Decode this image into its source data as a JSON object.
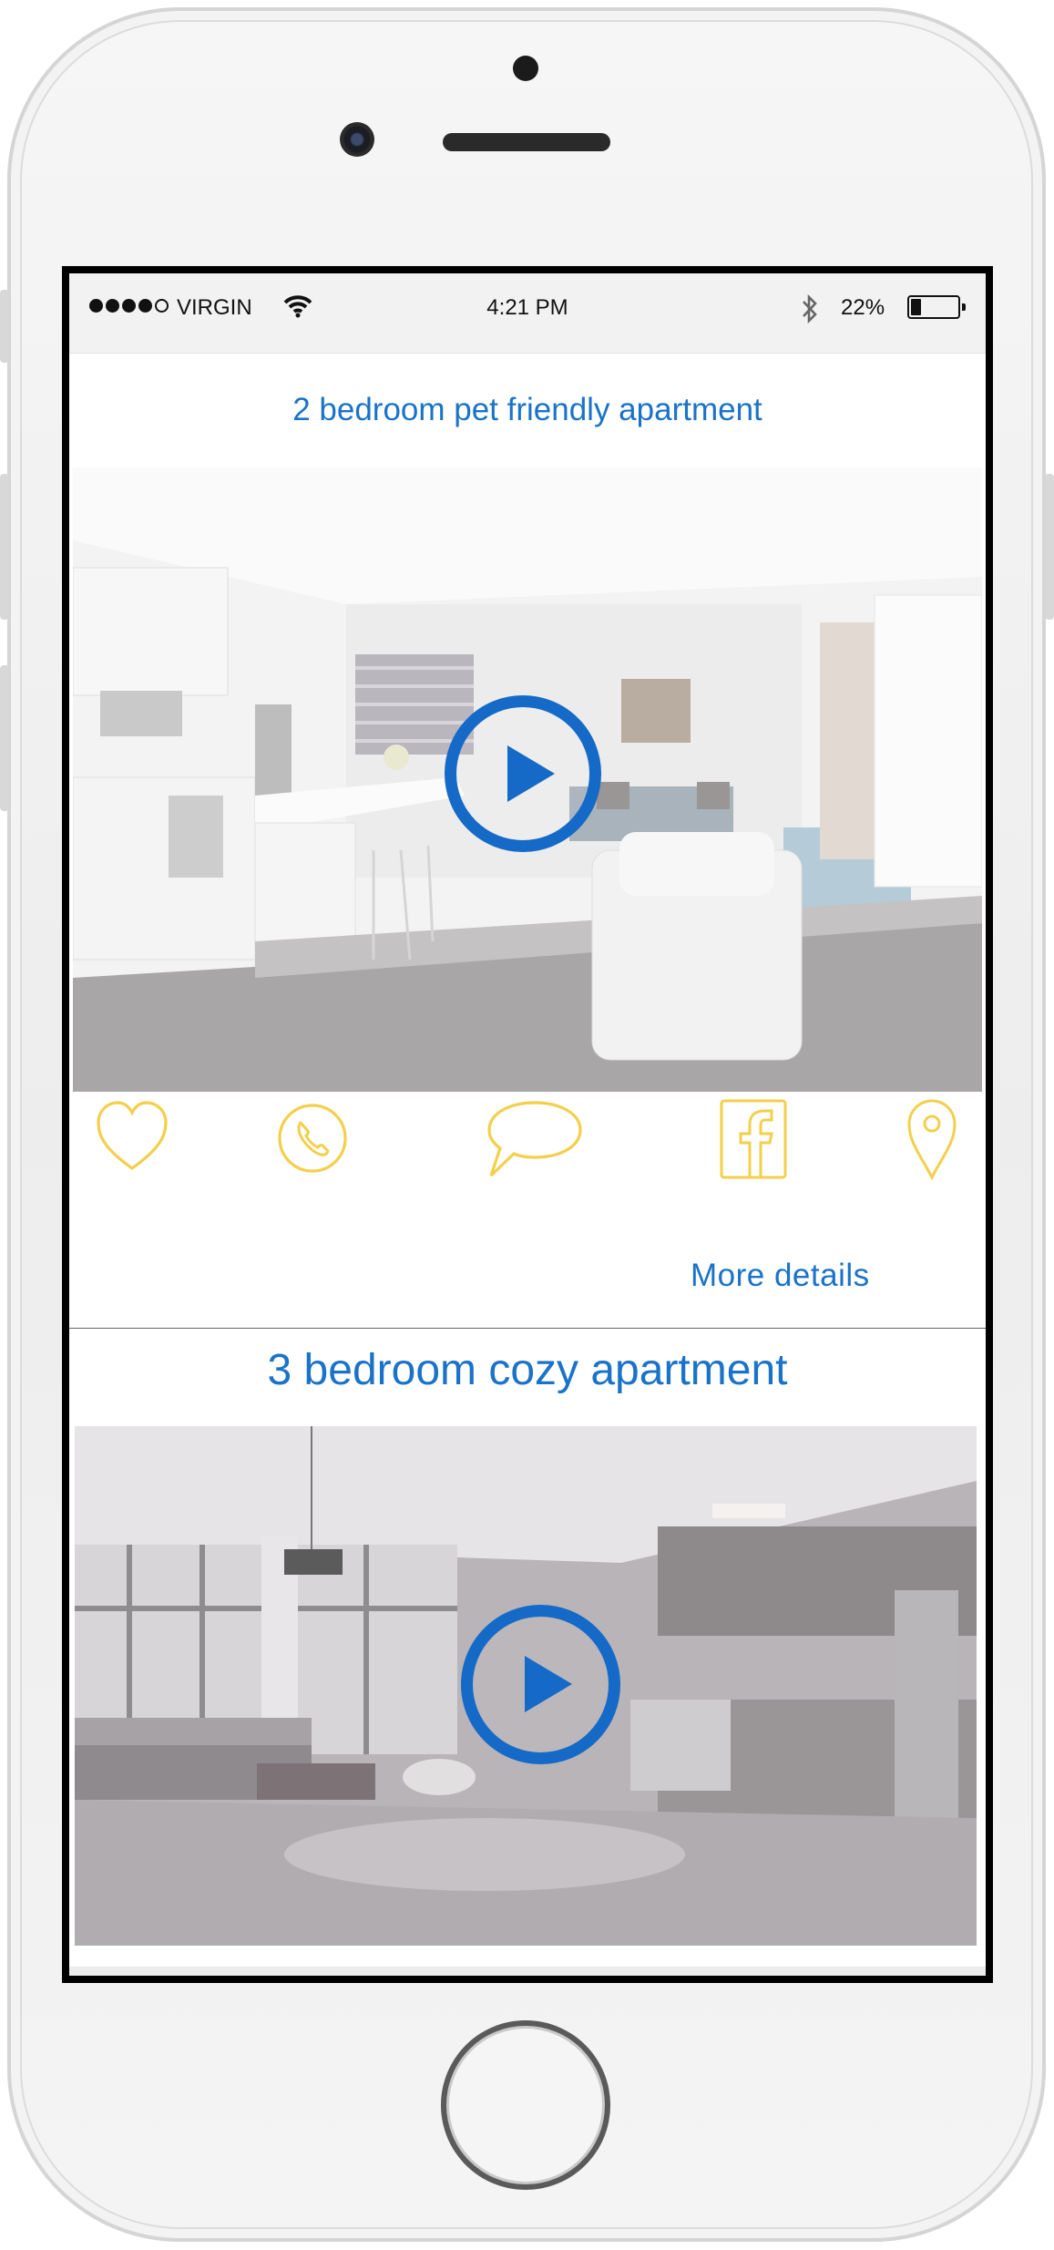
{
  "status_bar": {
    "carrier": "VIRGIN",
    "time": "4:21 PM",
    "battery_percent_text": "22%",
    "battery_level": 0.22,
    "signal_bars_filled": 4,
    "signal_bars_total": 5,
    "icons": [
      "wifi-icon",
      "bluetooth-icon",
      "battery-icon"
    ]
  },
  "listings": [
    {
      "title": "2 bedroom pet friendly apartment",
      "media": "video-thumbnail",
      "actions": [
        "favorite-heart-icon",
        "call-phone-icon",
        "chat-bubble-icon",
        "facebook-icon",
        "location-pin-icon"
      ],
      "more_details_label": "More details"
    },
    {
      "title": "3 bedroom cozy apartment",
      "media": "video-thumbnail"
    }
  ],
  "colors": {
    "accent_blue": "#1a73c8",
    "play_blue": "#1569c7",
    "icon_yellow": "#f4cf4a",
    "status_bar_bg": "#f2f2f2"
  }
}
